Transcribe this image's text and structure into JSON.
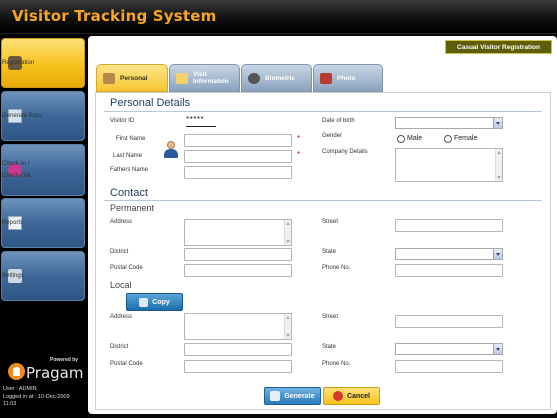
{
  "app": {
    "title": "Visitor Tracking System"
  },
  "sidebar": {
    "items": [
      {
        "label": "Registration",
        "icon": "registration-icon",
        "active": true
      },
      {
        "label": "Generate Pass",
        "icon": "generate-pass-icon",
        "active": false
      },
      {
        "label": "Check-In / Check-Out",
        "icon": "check-in-icon",
        "active": false
      },
      {
        "label": "Reports",
        "icon": "reports-icon",
        "active": false
      },
      {
        "label": "Settings",
        "icon": "settings-icon",
        "active": false
      }
    ],
    "powered_by": "Powered by",
    "brand": "Pragam",
    "status": {
      "user": "User : ADMIN",
      "logged_in": "Logged in at : 10-Dec-2009",
      "time": "11:03"
    }
  },
  "header": {
    "casual_registration": "Casual Visitor Registration"
  },
  "tabs": [
    {
      "label": "Personal",
      "active": true
    },
    {
      "label": "Visit Information",
      "line1": "Visit",
      "line2": "Information",
      "active": false
    },
    {
      "label": "Biometric",
      "active": false
    },
    {
      "label": "Photo",
      "active": false
    }
  ],
  "personal_details": {
    "heading": "Personal Details",
    "visitor_id_label": "Visitor ID",
    "visitor_id_value": "*****",
    "first_name_label": "First Name",
    "last_name_label": "Last Name",
    "fathers_name_label": "Fathers Name",
    "dob_label": "Date of birth",
    "gender_label": "Gender",
    "gender_options": [
      "Male",
      "Female"
    ],
    "company_label": "Company Details",
    "required_marker": "*"
  },
  "contact": {
    "heading": "Contact",
    "permanent": {
      "heading": "Permanent",
      "address_label": "Address",
      "street_label": "Street",
      "district_label": "District",
      "state_label": "State",
      "postal_label": "Postal Code",
      "phone_label": "Phone No."
    },
    "local": {
      "heading": "Local",
      "copy_label": "Copy",
      "address_label": "Address",
      "street_label": "Street",
      "district_label": "District",
      "state_label": "State",
      "postal_label": "Postal Code",
      "phone_label": "Phone No."
    }
  },
  "actions": {
    "generate_label": "Generate",
    "cancel_label": "Cancel"
  },
  "colors": {
    "title": "#f5a623",
    "active_yellow": "#f7c21c",
    "nav_blue": "#3e6898",
    "heading_blue": "#1f3e66",
    "required_red": "#dd0000"
  }
}
